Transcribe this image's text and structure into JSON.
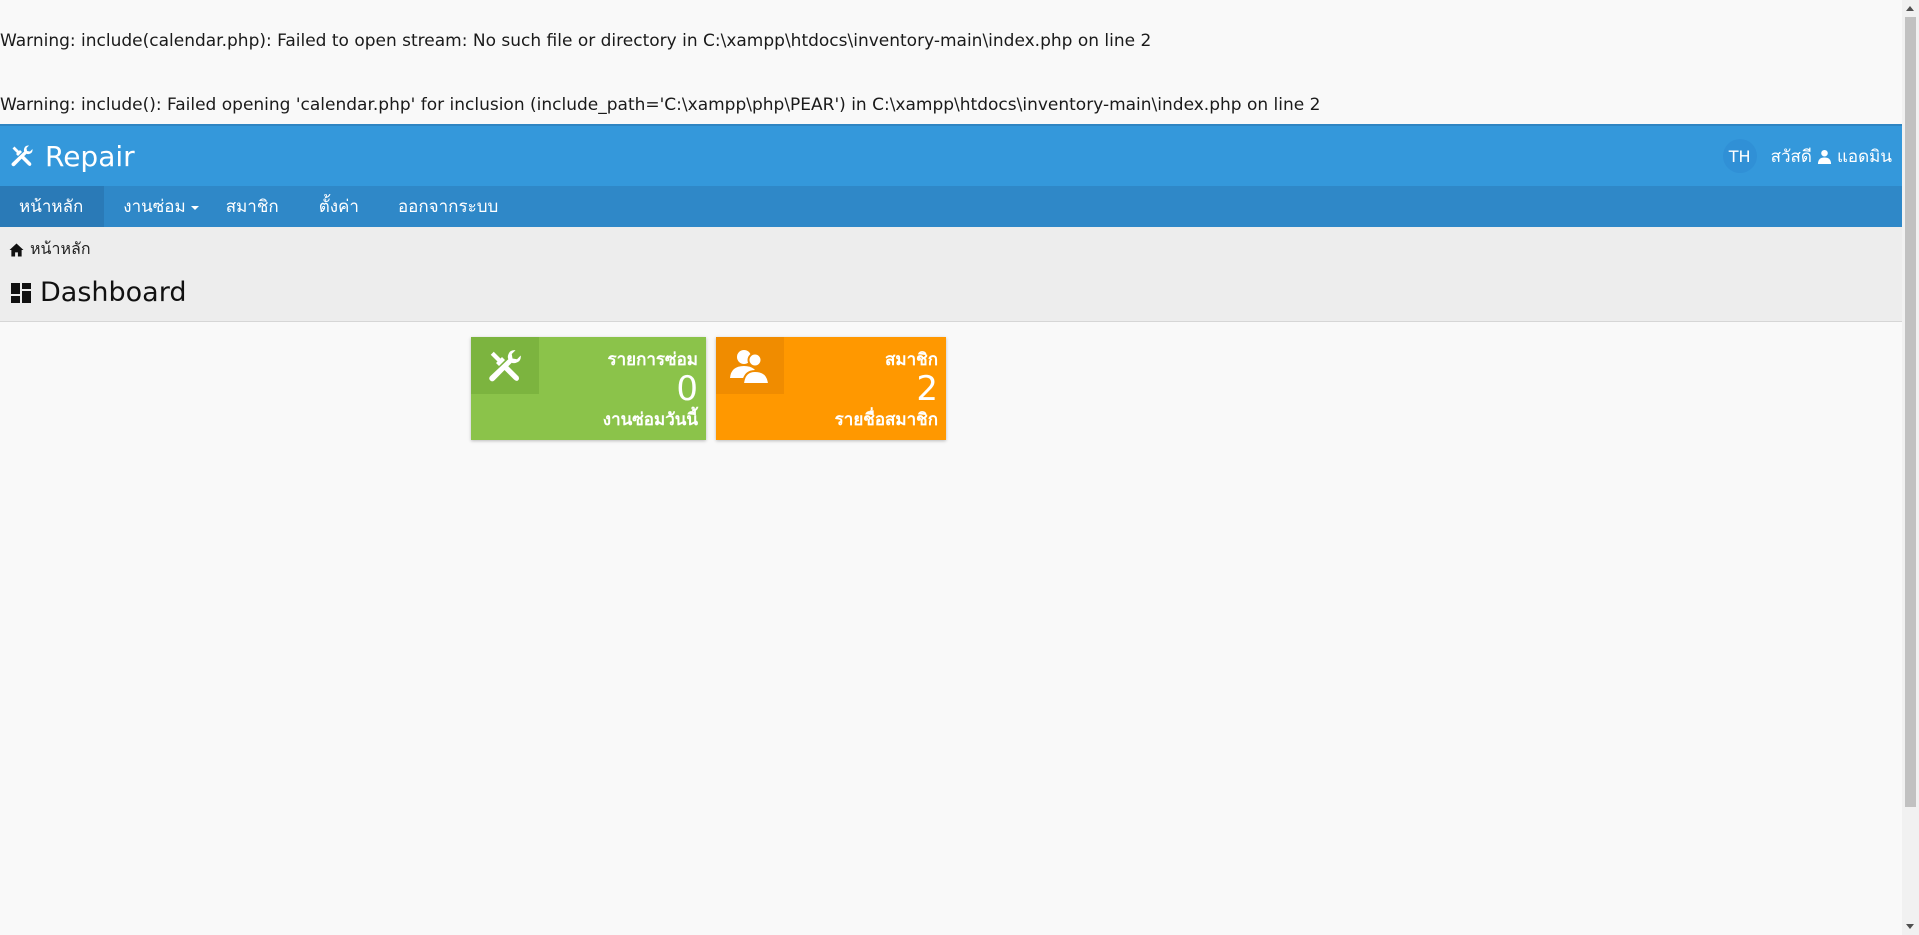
{
  "warnings": [
    "Warning: include(calendar.php): Failed to open stream: No such file or directory in C:\\xampp\\htdocs\\inventory-main\\index.php on line 2",
    "Warning: include(): Failed opening 'calendar.php' for inclusion (include_path='C:\\xampp\\php\\PEAR') in C:\\xampp\\htdocs\\inventory-main\\index.php on line 2"
  ],
  "topbar": {
    "brand_icon": "tools-icon",
    "brand_name": "Repair",
    "lang": "TH",
    "greeting": "สวัสดี",
    "user_name": "แอดมิน"
  },
  "nav": {
    "items": [
      {
        "label": "หน้าหลัก",
        "active": true
      },
      {
        "label": "งานซ่อม",
        "dropdown": true
      },
      {
        "label": "สมาชิก"
      },
      {
        "label": "ตั้งค่า"
      },
      {
        "label": "ออกจากระบบ"
      }
    ]
  },
  "breadcrumb": {
    "home": "หน้าหลัก"
  },
  "page": {
    "title": "Dashboard"
  },
  "tiles": [
    {
      "icon": "tools-icon",
      "label": "รายการซ่อม",
      "value": "0",
      "sub": "งานซ่อมวันนี้",
      "color": "#8bc34a"
    },
    {
      "icon": "users-icon",
      "label": "สมาชิก",
      "value": "2",
      "sub": "รายชื่อสมาชิก",
      "color": "#ff9800"
    }
  ],
  "colors": {
    "primary": "#3498db",
    "nav": "#2f88c8"
  }
}
